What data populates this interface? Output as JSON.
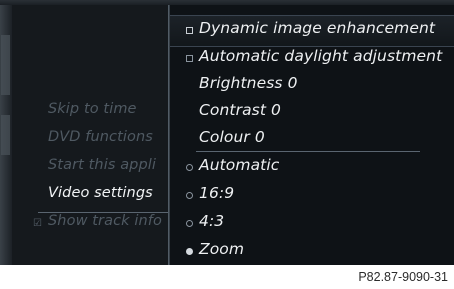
{
  "left_menu": {
    "items": [
      {
        "label": "Skip to time"
      },
      {
        "label": "DVD functions"
      },
      {
        "label": "Start this appli"
      },
      {
        "label": "Video settings"
      },
      {
        "label": "Show track info"
      }
    ],
    "active_index": 3,
    "checked_item": "Show track info"
  },
  "right_menu": {
    "items": [
      {
        "label": "Dynamic image enhancement",
        "control": "checkbox",
        "checked": false,
        "selected": true
      },
      {
        "label": "Automatic daylight adjustment",
        "control": "checkbox",
        "checked": false
      },
      {
        "label": "Brightness 0",
        "control": "none"
      },
      {
        "label": "Contrast 0",
        "control": "none"
      },
      {
        "label": "Colour 0",
        "control": "none"
      },
      {
        "label": "Automatic",
        "control": "radio",
        "checked": false
      },
      {
        "label": "16:9",
        "control": "radio",
        "checked": false
      },
      {
        "label": "4:3",
        "control": "radio",
        "checked": false
      },
      {
        "label": "Zoom",
        "control": "radio",
        "checked": true
      }
    ]
  },
  "caption": "P82.87-9090-31",
  "colors": {
    "background": "#101418",
    "text_active": "#eef0f2",
    "text_dim": "#4f5962"
  }
}
